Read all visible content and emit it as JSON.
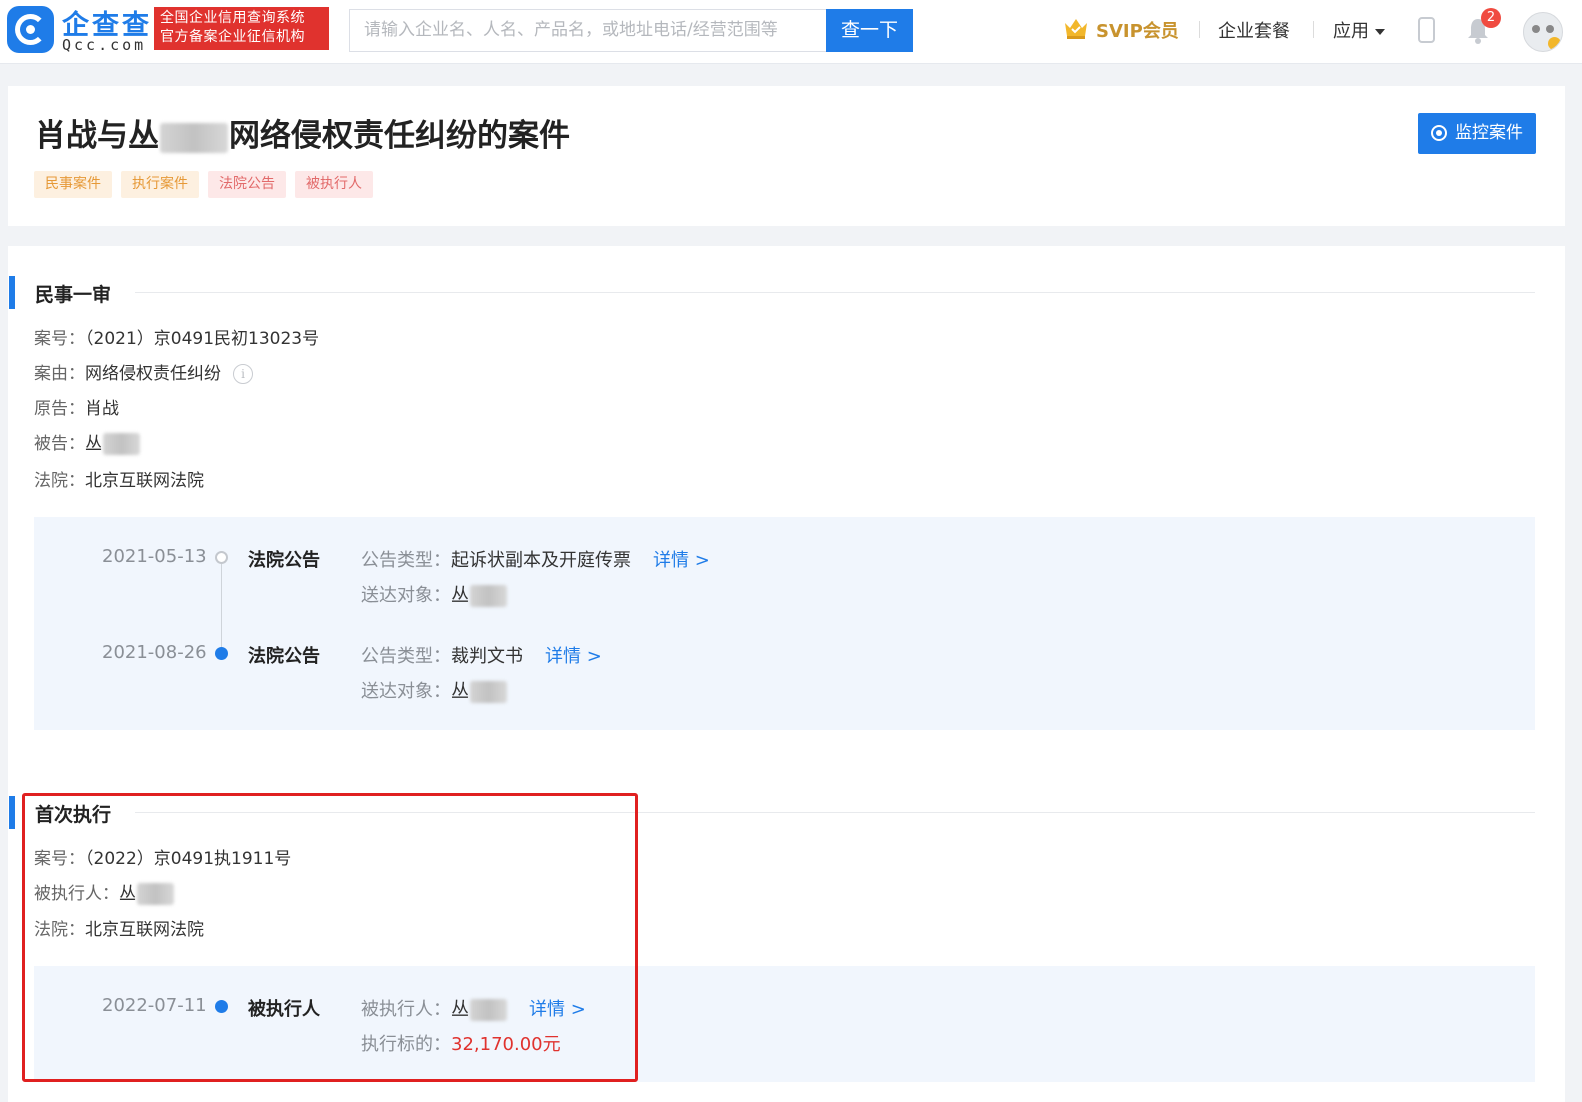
{
  "header": {
    "logo_cn": "企查查",
    "logo_en": "Qcc.com",
    "slogan_line1": "全国企业信用查询系统",
    "slogan_line2": "官方备案企业征信机构",
    "search_placeholder": "请输入企业名、人名、产品名，或地址电话/经营范围等",
    "search_button": "查一下",
    "svip": "SVIP会员",
    "nav_package": "企业套餐",
    "nav_app": "应用",
    "notification_count": "2",
    "accent": "#1f7ce8"
  },
  "case": {
    "title_prefix": "肖战与丛",
    "title_suffix": "网络侵权责任纠纷的案件",
    "tags": [
      "民事案件",
      "执行案件",
      "法院公告",
      "被执行人"
    ],
    "monitor_button": "监控案件"
  },
  "first_trial": {
    "title": "民事一审",
    "case_no_label": "案号：",
    "case_no": "（2021）京0491民初13023号",
    "cause_label": "案由：",
    "cause": "网络侵权责任纠纷",
    "plaintiff_label": "原告：",
    "plaintiff": "肖战",
    "defendant_label": "被告：",
    "defendant": "丛",
    "court_label": "法院：",
    "court": "北京互联网法院",
    "timeline": [
      {
        "date": "2021-05-13",
        "type": "法院公告",
        "k1": "公告类型：",
        "v1": "起诉状副本及开庭传票",
        "link": "详情 >",
        "k2": "送达对象：",
        "v2": "丛"
      },
      {
        "date": "2021-08-26",
        "type": "法院公告",
        "k1": "公告类型：",
        "v1": "裁判文书",
        "link": "详情 >",
        "k2": "送达对象：",
        "v2": "丛"
      }
    ]
  },
  "execution": {
    "title": "首次执行",
    "case_no_label": "案号：",
    "case_no": "（2022）京0491执1911号",
    "debtor_label": "被执行人：",
    "debtor": "丛",
    "court_label": "法院：",
    "court": "北京互联网法院",
    "timeline": [
      {
        "date": "2022-07-11",
        "type": "被执行人",
        "k1": "被执行人：",
        "v1": "丛",
        "link": "详情 >",
        "k2": "执行标的：",
        "v2": "32,170.00元"
      }
    ]
  }
}
